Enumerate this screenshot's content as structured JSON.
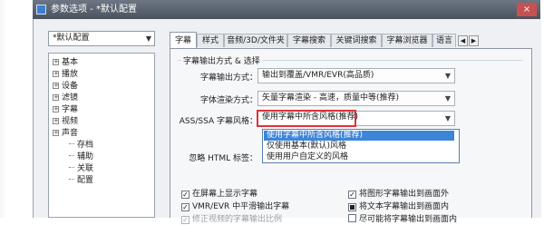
{
  "window": {
    "title": "参数选项 - *默认配置",
    "close_label": "×"
  },
  "profile": {
    "selected": "*默认配置"
  },
  "tree": {
    "items": [
      {
        "label": "基本",
        "expander": "+"
      },
      {
        "label": "播放",
        "expander": "+"
      },
      {
        "label": "设备",
        "expander": "+"
      },
      {
        "label": "滤镜",
        "expander": "+"
      },
      {
        "label": "字幕",
        "expander": "+"
      },
      {
        "label": "视频",
        "expander": "+"
      },
      {
        "label": "声音",
        "expander": "+"
      }
    ],
    "children": [
      {
        "label": "存档"
      },
      {
        "label": "辅助"
      },
      {
        "label": "关联"
      },
      {
        "label": "配置"
      }
    ]
  },
  "tabs": [
    {
      "label": "字幕"
    },
    {
      "label": "样式"
    },
    {
      "label": "音频/3D/文件夹"
    },
    {
      "label": "字幕搜索"
    },
    {
      "label": "关键词搜索"
    },
    {
      "label": "字幕浏览器"
    },
    {
      "label": "语言"
    }
  ],
  "tab_scroll": {
    "left": "◀",
    "right": "▶"
  },
  "panel": {
    "group_title": "字幕输出方式 & 选择",
    "rows": [
      {
        "label": "字幕输出方式：",
        "value": "输出到覆盖/VMR/EVR(高品质)"
      },
      {
        "label": "字体渲染方式：",
        "value": "矢量字幕渲染 - 高速，质量中等(推荐)"
      },
      {
        "label": "ASS/SSA 字幕风格：",
        "value": "使用字幕中所含风格(推荐)"
      },
      {
        "label": "忽略 HTML 标签："
      }
    ],
    "dropdown_options": [
      {
        "label": "使用字幕中所含风格(推荐)",
        "selected": true
      },
      {
        "label": "仅使用基本(默认)风格",
        "selected": false
      },
      {
        "label": "使用用户自定义的风格",
        "selected": false
      }
    ],
    "left_checks": [
      {
        "label": "在屏幕上显示字幕",
        "checked": true,
        "disabled": false
      },
      {
        "label": "VMR/EVR 中平滑输出字幕",
        "checked": true,
        "disabled": false
      },
      {
        "label": "修正视频的字幕输出比例",
        "checked": true,
        "disabled": true
      }
    ],
    "right_checks": [
      {
        "label": "将图形字幕输出到画面外",
        "checked": true
      },
      {
        "label": "将文本字幕输出到画面内",
        "checked": "partial"
      },
      {
        "label": "尽可能将字幕输出到画面内",
        "checked": false
      }
    ]
  },
  "icons": {
    "dropdown_arrow": "chevron-down-icon",
    "check_mark": "✓"
  },
  "colors": {
    "highlight_border": "#d9343a",
    "selection": "#3d85d9",
    "titlebar": "#4a525e"
  }
}
